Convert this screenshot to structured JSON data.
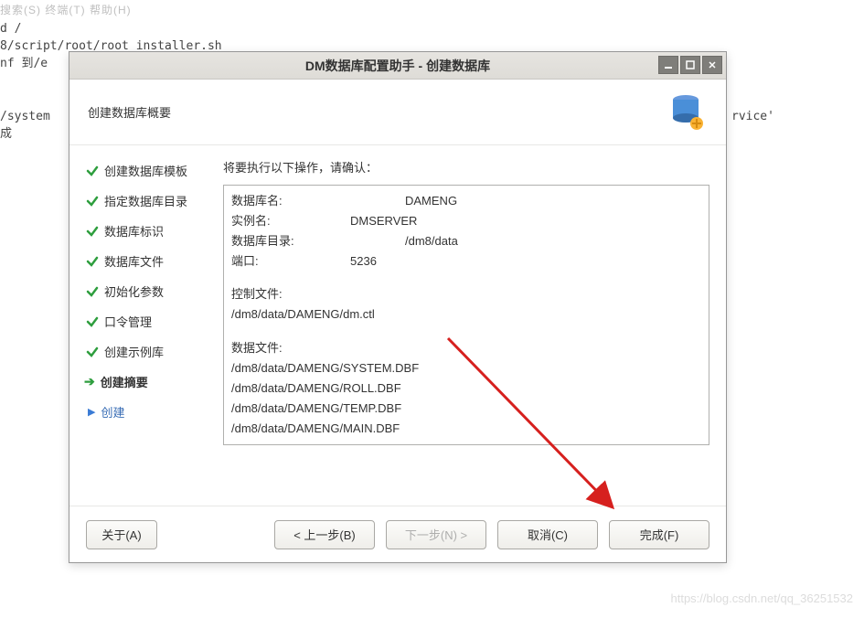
{
  "bg": {
    "menu": "搜索(S)   终端(T)   帮助(H)",
    "line1": "d /",
    "line2": "8/script/root/root_installer.sh",
    "line3": "nf 到/e",
    "line4": "/system",
    "line5": "成",
    "line6": "rvice'"
  },
  "dialog": {
    "title": "DM数据库配置助手 - 创建数据库",
    "header_title": "创建数据库概要"
  },
  "steps": {
    "s1": "创建数据库模板",
    "s2": "指定数据库目录",
    "s3": "数据库标识",
    "s4": "数据库文件",
    "s5": "初始化参数",
    "s6": "口令管理",
    "s7": "创建示例库",
    "s8": "创建摘要",
    "s9": "创建"
  },
  "main": {
    "prompt": "将要执行以下操作，请确认：",
    "labels": {
      "db_name": "数据库名:",
      "inst_name": "实例名:",
      "db_dir": "数据库目录:",
      "port": "端口:",
      "ctrl_file": "控制文件:",
      "data_file": "数据文件:"
    },
    "values": {
      "db_name": "DAMENG",
      "inst_name": "DMSERVER",
      "db_dir": "/dm8/data",
      "port": "5236",
      "ctrl_path": "/dm8/data/DAMENG/dm.ctl",
      "df1": "/dm8/data/DAMENG/SYSTEM.DBF",
      "df2": "/dm8/data/DAMENG/ROLL.DBF",
      "df3": "/dm8/data/DAMENG/TEMP.DBF",
      "df4": "/dm8/data/DAMENG/MAIN.DBF"
    }
  },
  "buttons": {
    "about": "关于(A)",
    "prev": "< 上一步(B)",
    "next": "下一步(N) >",
    "cancel": "取消(C)",
    "finish": "完成(F)"
  },
  "watermark": "https://blog.csdn.net/qq_36251532"
}
